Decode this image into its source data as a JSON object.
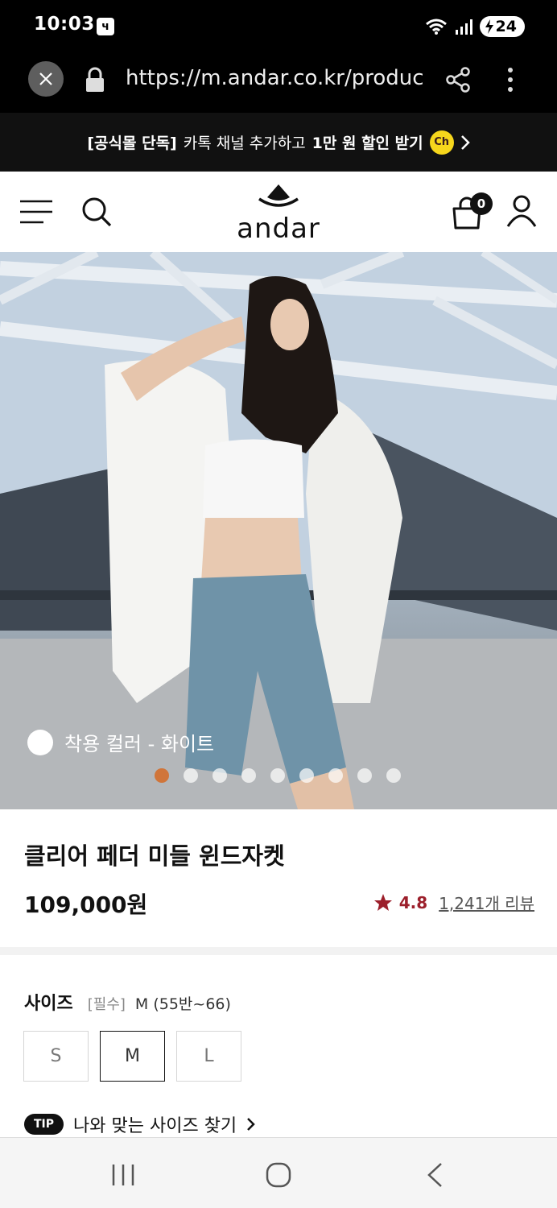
{
  "status_bar": {
    "time": "10:03",
    "app_icon": "ч",
    "battery": "24"
  },
  "browser": {
    "url": "https://m.andar.co.kr/product/"
  },
  "promo": {
    "bold_text": "[공식몰 단독]",
    "text": "카톡 채널 추가하고",
    "highlight": "1만 원 할인 받기",
    "badge": "Ch"
  },
  "header": {
    "logo_text": "andar",
    "cart_count": "0"
  },
  "hero": {
    "color_label": "착용 컬러 - 화이트",
    "dots_total": 9,
    "active_dot": 0
  },
  "product": {
    "title": "클리어 페더 미들 윈드자켓",
    "price": "109,000원",
    "rating": "4.8",
    "reviews": "1,241개 리뷰"
  },
  "size": {
    "label": "사이즈",
    "required": "[필수]",
    "selected_text": "M (55반~66)",
    "options": [
      "S",
      "M",
      "L"
    ],
    "selected": "M",
    "tip_badge": "TIP",
    "tip_text": "나와 맞는 사이즈 찾기"
  },
  "colors": {
    "rating_red": "#9c1f2b",
    "active_dot": "#d0753a",
    "kakao_yellow": "#f6d61c"
  }
}
